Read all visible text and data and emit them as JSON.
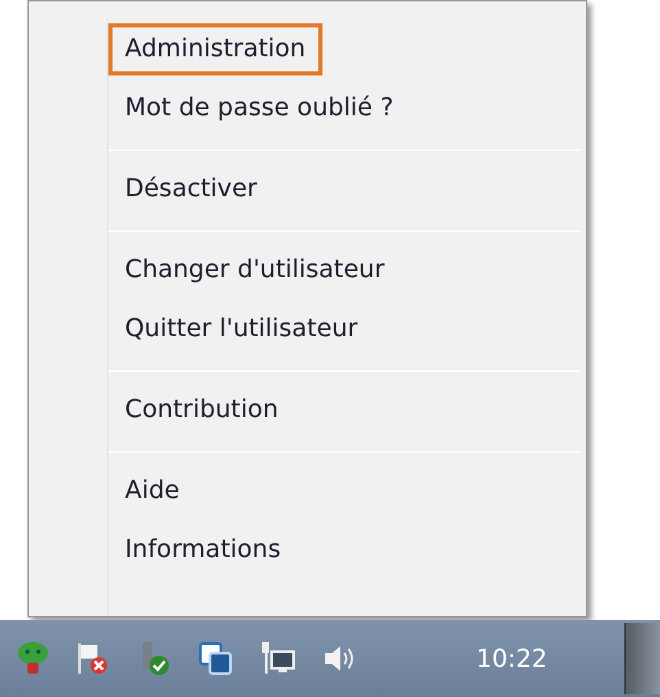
{
  "menu": {
    "groups": [
      {
        "items": [
          {
            "label": "Administration",
            "highlighted": true
          },
          {
            "label": "Mot de passe oublié ?",
            "highlighted": false
          }
        ]
      },
      {
        "items": [
          {
            "label": "Désactiver",
            "highlighted": false
          }
        ]
      },
      {
        "items": [
          {
            "label": "Changer d'utilisateur",
            "highlighted": false
          },
          {
            "label": "Quitter l'utilisateur",
            "highlighted": false
          }
        ]
      },
      {
        "items": [
          {
            "label": "Contribution",
            "highlighted": false
          }
        ]
      },
      {
        "items": [
          {
            "label": "Aide",
            "highlighted": false
          },
          {
            "label": "Informations",
            "highlighted": false
          }
        ]
      }
    ]
  },
  "taskbar": {
    "tray_icons": [
      {
        "kind": "robot"
      },
      {
        "kind": "flag"
      },
      {
        "kind": "usb"
      },
      {
        "kind": "windows"
      },
      {
        "kind": "network"
      },
      {
        "kind": "volume"
      }
    ],
    "clock": "10:22"
  }
}
